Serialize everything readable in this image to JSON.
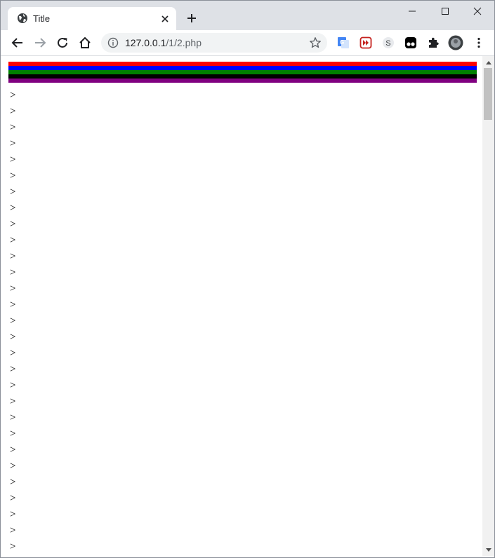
{
  "browser": {
    "tab": {
      "title": "Title",
      "icon": "globe-icon"
    },
    "omnibox": {
      "host": "127.0.0.1",
      "path": "/1/2.php"
    },
    "extensions": [
      "google-translate-icon",
      "red-extension-icon",
      "s-extension-icon",
      "tampermonkey-icon",
      "extensions-puzzle-icon",
      "profile-avatar-icon"
    ]
  },
  "page": {
    "stripe_colors": [
      "#ff0000",
      "#0000ff",
      "#008000",
      "#000000",
      "#800080"
    ],
    "lines": [
      ">",
      ">",
      ">",
      ">",
      ">",
      ">",
      ">",
      ">",
      ">",
      ">",
      ">",
      ">",
      ">",
      ">",
      ">",
      ">",
      ">",
      ">",
      ">",
      ">",
      ">",
      ">",
      ">",
      ">",
      ">",
      ">",
      ">",
      ">",
      ">"
    ]
  },
  "scrollbar": {
    "position": 0.0
  }
}
